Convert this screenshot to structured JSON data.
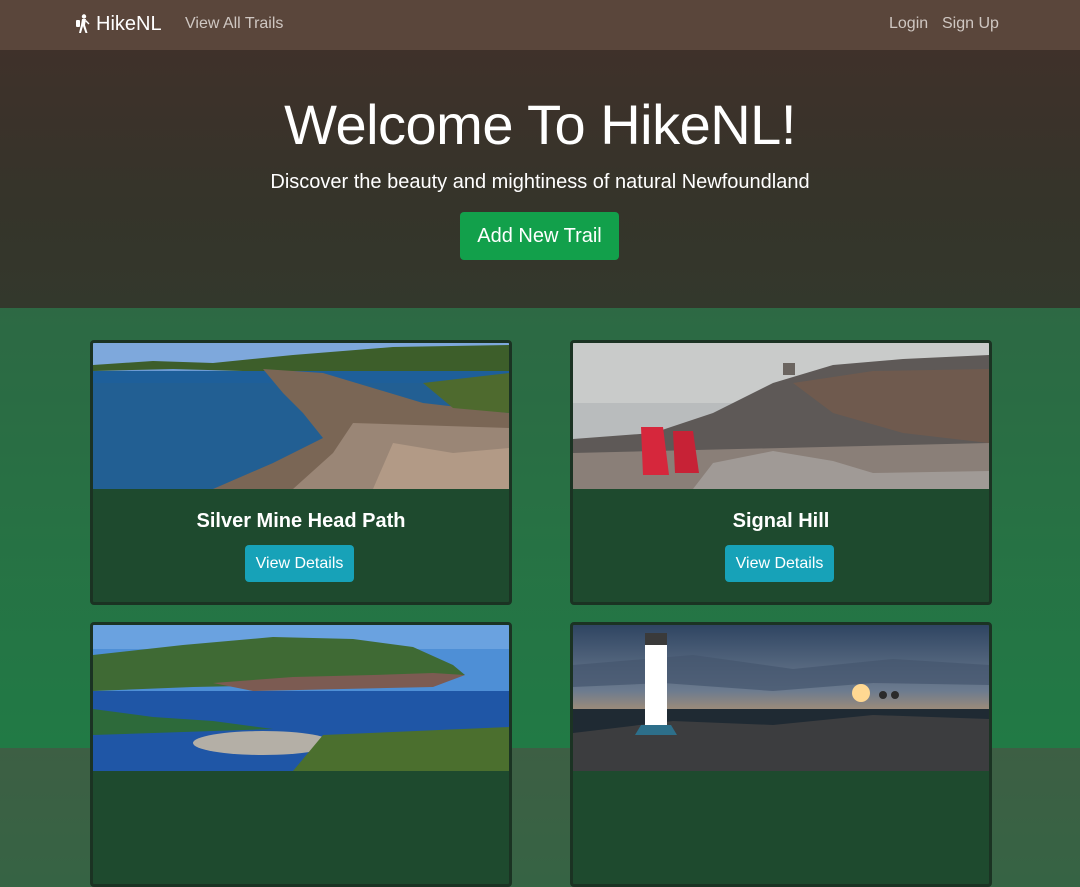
{
  "nav": {
    "brand": "HikeNL",
    "view_all": "View All Trails",
    "login": "Login",
    "signup": "Sign Up"
  },
  "hero": {
    "title": "Welcome To HikeNL!",
    "subtitle": "Discover the beauty and mightiness of natural Newfoundland",
    "add_button": "Add New Trail"
  },
  "cards": [
    {
      "title": "Silver Mine Head Path",
      "button": "View Details"
    },
    {
      "title": "Signal Hill",
      "button": "View Details"
    },
    {
      "title": "",
      "button": ""
    },
    {
      "title": "",
      "button": ""
    }
  ],
  "colors": {
    "navbar": "#5a463b",
    "success": "#12a04b",
    "info": "#17a2b8"
  }
}
